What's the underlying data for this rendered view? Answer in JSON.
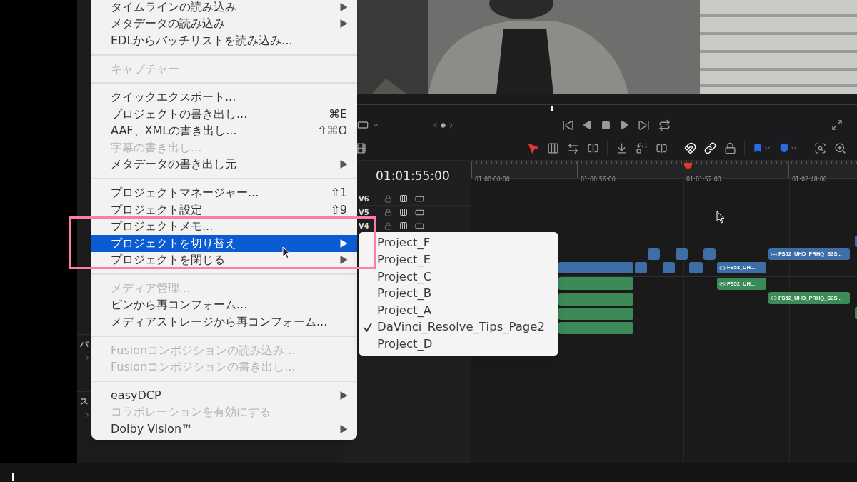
{
  "sidebar": {
    "labels": [
      "パ",
      "ス"
    ]
  },
  "timeline": {
    "timecode": "01:01:55:00",
    "ruler": [
      "01:00:00:00",
      "01:00:56:00",
      "01:01:52:00",
      "01:02:48:00"
    ],
    "tracks": [
      "V6",
      "V5",
      "V4"
    ],
    "clips": [
      {
        "kind": "video"
      },
      {
        "kind": "video"
      },
      {
        "kind": "video"
      },
      {
        "kind": "video"
      },
      {
        "kind": "video"
      },
      {
        "kind": "video"
      },
      {
        "kind": "video"
      },
      {
        "kind": "video",
        "label": "FS52_UH..."
      },
      {
        "kind": "video",
        "label": "FS52_UHD_PRHQ_S3S..."
      },
      {
        "kind": "video"
      },
      {
        "kind": "audio"
      },
      {
        "kind": "audio"
      },
      {
        "kind": "audio"
      },
      {
        "kind": "audio"
      },
      {
        "kind": "audio",
        "label": "FS52_UH..."
      },
      {
        "kind": "audio",
        "label": "FS52_UHD_PRHQ_S3S..."
      },
      {
        "kind": "audio"
      }
    ]
  },
  "menu": {
    "items": [
      {
        "kind": "item",
        "label": "タイムラインの読み込み",
        "has_submenu": true,
        "disabled": false,
        "selected": false
      },
      {
        "kind": "item",
        "label": "メタデータの読み込み",
        "has_submenu": true,
        "disabled": false,
        "selected": false
      },
      {
        "kind": "item",
        "label": "EDLからバッチリストを読み込み...",
        "has_submenu": false,
        "disabled": false,
        "selected": false
      },
      {
        "kind": "separator"
      },
      {
        "kind": "item",
        "label": "キャプチャー",
        "has_submenu": false,
        "disabled": true,
        "selected": false
      },
      {
        "kind": "separator"
      },
      {
        "kind": "item",
        "label": "クイックエクスポート...",
        "has_submenu": false,
        "disabled": false,
        "selected": false
      },
      {
        "kind": "item",
        "label": "プロジェクトの書き出し...",
        "shortcut": "⌘E",
        "has_submenu": false,
        "disabled": false,
        "selected": false
      },
      {
        "kind": "item",
        "label": "AAF、XMLの書き出し...",
        "shortcut": "⇧⌘O",
        "has_submenu": false,
        "disabled": false,
        "selected": false
      },
      {
        "kind": "item",
        "label": "字幕の書き出し...",
        "has_submenu": false,
        "disabled": true,
        "selected": false
      },
      {
        "kind": "item",
        "label": "メタデータの書き出し元",
        "has_submenu": true,
        "disabled": false,
        "selected": false
      },
      {
        "kind": "separator"
      },
      {
        "kind": "item",
        "label": "プロジェクトマネージャー...",
        "shortcut": "⇧1",
        "has_submenu": false,
        "disabled": false,
        "selected": false
      },
      {
        "kind": "item",
        "label": "プロジェクト設定",
        "shortcut": "⇧9",
        "has_submenu": false,
        "disabled": false,
        "selected": false
      },
      {
        "kind": "item",
        "label": "プロジェクトメモ...",
        "has_submenu": false,
        "disabled": false,
        "selected": false
      },
      {
        "kind": "item",
        "label": "プロジェクトを切り替え",
        "has_submenu": true,
        "disabled": false,
        "selected": true
      },
      {
        "kind": "item",
        "label": "プロジェクトを閉じる",
        "has_submenu": true,
        "disabled": false,
        "selected": false
      },
      {
        "kind": "separator"
      },
      {
        "kind": "item",
        "label": "メディア管理...",
        "has_submenu": false,
        "disabled": true,
        "selected": false
      },
      {
        "kind": "item",
        "label": "ビンから再コンフォーム...",
        "has_submenu": false,
        "disabled": false,
        "selected": false
      },
      {
        "kind": "item",
        "label": "メディアストレージから再コンフォーム...",
        "has_submenu": false,
        "disabled": false,
        "selected": false
      },
      {
        "kind": "separator"
      },
      {
        "kind": "item",
        "label": "Fusionコンポジションの読み込み...",
        "has_submenu": false,
        "disabled": true,
        "selected": false
      },
      {
        "kind": "item",
        "label": "Fusionコンポジションの書き出し...",
        "has_submenu": false,
        "disabled": true,
        "selected": false
      },
      {
        "kind": "separator"
      },
      {
        "kind": "item",
        "label": "easyDCP",
        "has_submenu": true,
        "disabled": false,
        "selected": false
      },
      {
        "kind": "item",
        "label": "コラボレーションを有効にする",
        "has_submenu": false,
        "disabled": true,
        "selected": false
      },
      {
        "kind": "item",
        "label": "Dolby Vision™",
        "has_submenu": true,
        "disabled": false,
        "selected": false
      }
    ]
  },
  "submenu": {
    "items": [
      {
        "label": "Project_F",
        "checked": false
      },
      {
        "label": "Project_E",
        "checked": false
      },
      {
        "label": "Project_C",
        "checked": false
      },
      {
        "label": "Project_B",
        "checked": false
      },
      {
        "label": "Project_A",
        "checked": false
      },
      {
        "label": "DaVinci_Resolve_Tips_Page2",
        "checked": true
      },
      {
        "label": "Project_D",
        "checked": false
      }
    ]
  }
}
